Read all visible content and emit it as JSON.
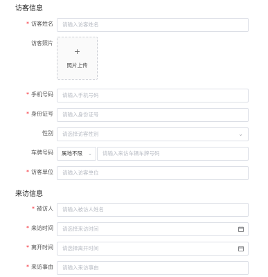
{
  "sections": {
    "visitor_info": "访客信息",
    "visit_info": "来访信息"
  },
  "visitor": {
    "name": {
      "label": "访客姓名",
      "placeholder": "请输入访客姓名"
    },
    "photo": {
      "label": "访客照片",
      "plus": "+",
      "upload_text": "照片上传"
    },
    "phone": {
      "label": "手机号码",
      "placeholder": "请输入手机号码"
    },
    "id_number": {
      "label": "身份证号",
      "placeholder": "请输入身份证号"
    },
    "gender": {
      "label": "性别",
      "placeholder": "请选择访客性别"
    },
    "plate": {
      "label": "车牌号码",
      "prefix_value": "属地不限",
      "placeholder": "请输入来访车辆车牌号码"
    },
    "company": {
      "label": "访客单位",
      "placeholder": "请输入访客单位"
    }
  },
  "visit": {
    "host": {
      "label": "被访人",
      "placeholder": "请输入被访人姓名"
    },
    "arrival_time": {
      "label": "来访时间",
      "placeholder": "请选择来访时间"
    },
    "leave_time": {
      "label": "离开时间",
      "placeholder": "请选择离开时间"
    },
    "reason": {
      "label": "来访事由",
      "placeholder": "请输入来访事由"
    }
  },
  "icons": {
    "required_marker": "*",
    "dropdown": "chevron-down-icon",
    "date": "calendar-icon"
  },
  "colors": {
    "required": "#f5222d",
    "border": "#dcdfe6",
    "placeholder": "#b8bcc4"
  }
}
